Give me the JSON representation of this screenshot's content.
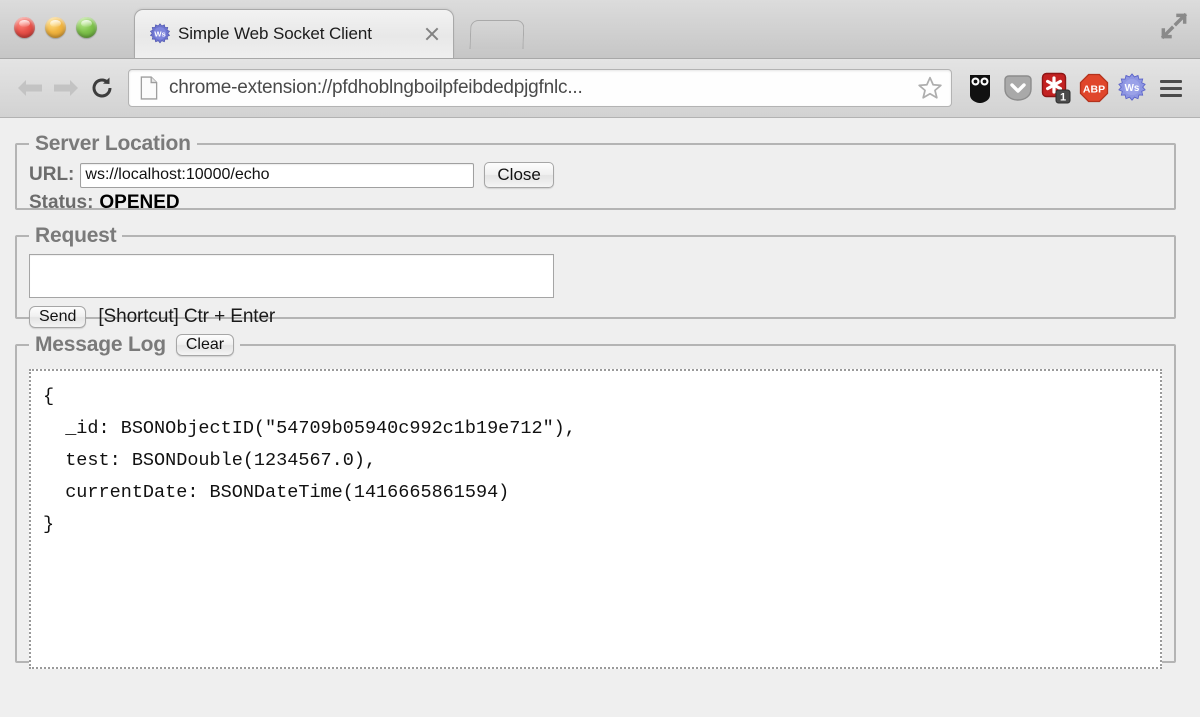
{
  "window": {
    "traffic_lights": [
      "close",
      "minimize",
      "zoom"
    ],
    "fullscreen_icon": "fullscreen-expand-icon"
  },
  "tab": {
    "favicon": "websocket-ws-icon",
    "title": "Simple Web Socket Client",
    "close_icon": "close-icon",
    "new_tab_label": ""
  },
  "toolbar": {
    "back_icon": "arrow-left-icon",
    "forward_icon": "arrow-right-icon",
    "reload_icon": "reload-icon",
    "page_icon": "page-document-icon",
    "url": "chrome-extension://pfdhoblngboilpfeibdedpjgfnlc...",
    "star_icon": "bookmark-star-icon",
    "menu_icon": "hamburger-menu-icon",
    "extensions": [
      {
        "name": "owl-icon",
        "label": "",
        "badge": ""
      },
      {
        "name": "pocket-chevron-icon",
        "label": "",
        "badge": ""
      },
      {
        "name": "asterisk-badge-icon",
        "label": "",
        "badge": "1"
      },
      {
        "name": "adblock-plus-icon",
        "label": "ABP",
        "badge": ""
      },
      {
        "name": "websocket-ws-icon",
        "label": "Ws",
        "badge": ""
      }
    ]
  },
  "server_location": {
    "legend": "Server Location",
    "url_label": "URL:",
    "url_value": "ws://localhost:10000/echo",
    "url_placeholder": "ws://localhost:10000/echo",
    "close_button": "Close",
    "status_label": "Status:",
    "status_value": "OPENED"
  },
  "request": {
    "legend": "Request",
    "textarea_value": "",
    "textarea_placeholder": "",
    "send_button": "Send",
    "shortcut_text": "[Shortcut] Ctr + Enter"
  },
  "message_log": {
    "legend": "Message Log",
    "clear_button": "Clear",
    "content": "{\n  _id: BSONObjectID(\"54709b05940c992c1b19e712\"),\n  test: BSONDouble(1234567.0),\n  currentDate: BSONDateTime(1416665861594)\n}"
  },
  "colors": {
    "legend_gray": "#7a7a7a",
    "status_black": "#000000",
    "panel_border": "#b4b4b4",
    "adblock_red": "#e0462b",
    "badge_red": "#c32222",
    "ws_blue": "#5a62c8"
  }
}
